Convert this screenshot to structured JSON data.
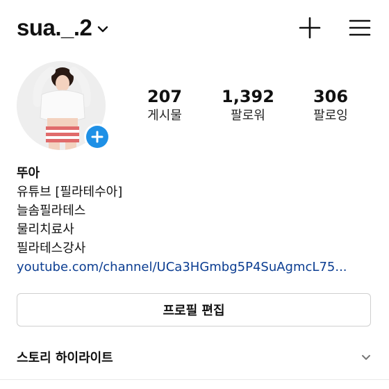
{
  "header": {
    "username": "sua._.2",
    "icons": {
      "dropdown": "chevron-down-icon",
      "create": "plus-icon",
      "menu": "hamburger-menu-icon"
    }
  },
  "profile": {
    "avatar_icon": "profile-photo",
    "add_story_icon": "plus-circle-icon",
    "stats": [
      {
        "value": "207",
        "label": "게시물"
      },
      {
        "value": "1,392",
        "label": "팔로워"
      },
      {
        "value": "306",
        "label": "팔로잉"
      }
    ]
  },
  "bio": {
    "name": "뚜아",
    "lines": [
      "유튜브 [필라테수아]",
      "늘솜필라테스",
      "물리치료사",
      "필라테스강사"
    ],
    "link": "youtube.com/channel/UCa3HGmbg5P4SuAgmcL75..."
  },
  "actions": {
    "edit_profile": "프로필 편집"
  },
  "highlights": {
    "label": "스토리 하이라이트",
    "icon": "chevron-down-icon"
  },
  "colors": {
    "accent_blue": "#1e90e6",
    "link": "#0b3d91",
    "border": "#cfcfcf"
  }
}
